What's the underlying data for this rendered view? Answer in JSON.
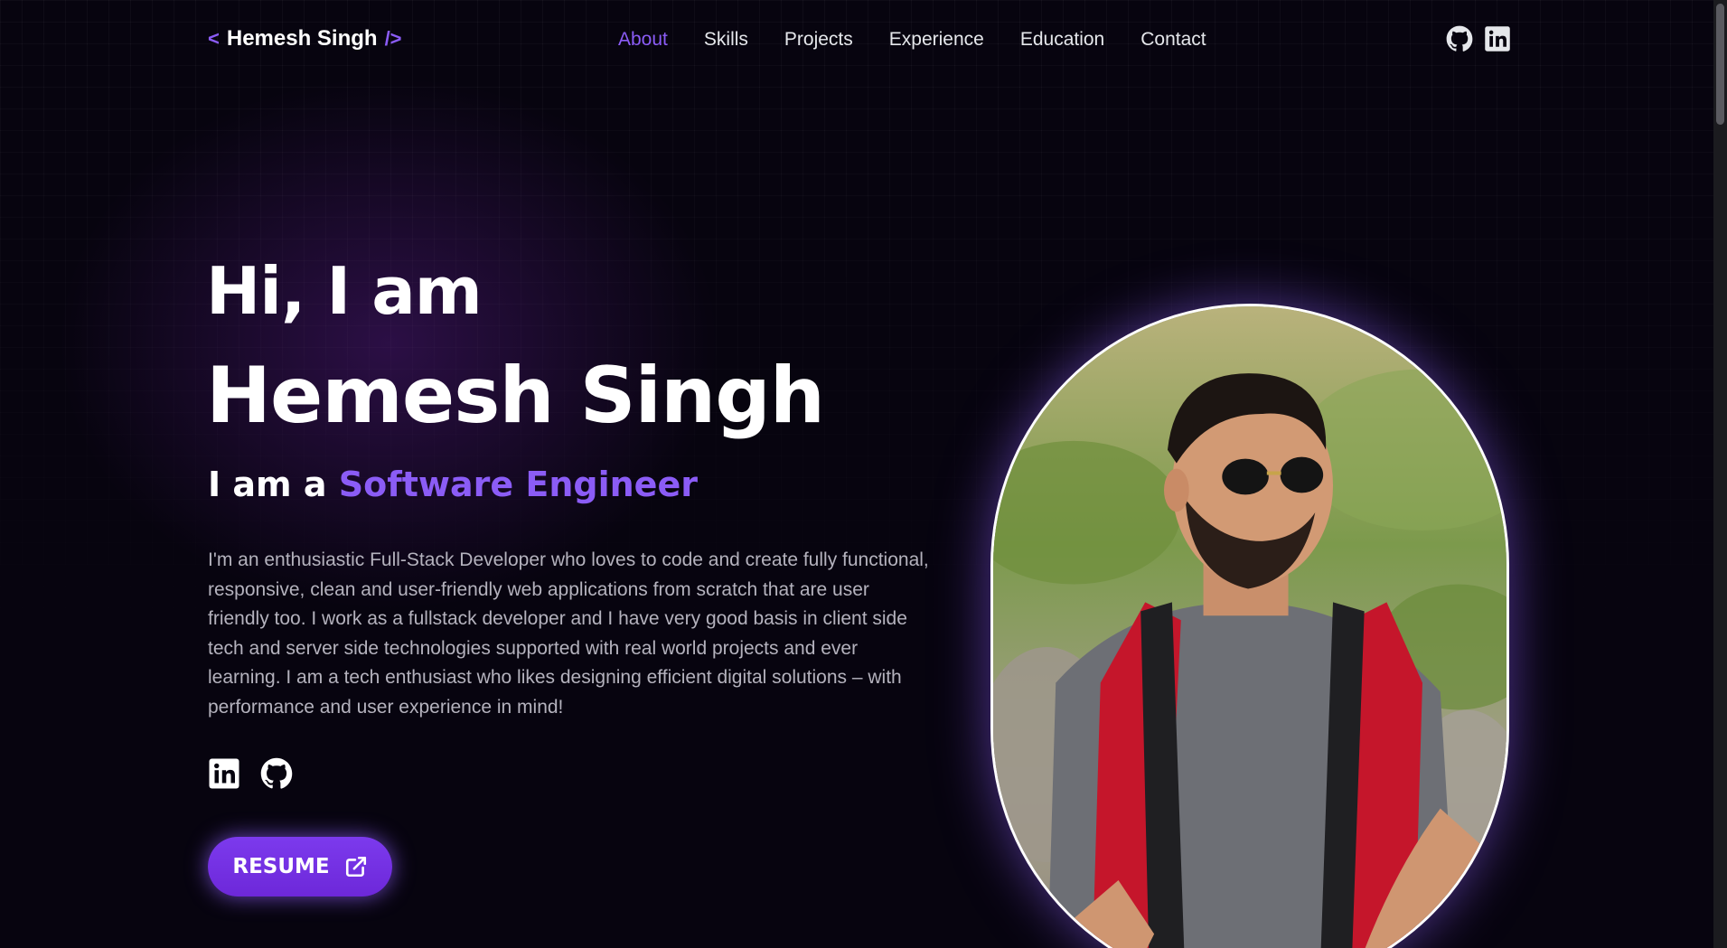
{
  "logo": {
    "open": "<",
    "text": "Hemesh Singh",
    "close": "/>"
  },
  "nav": {
    "items": [
      {
        "label": "About",
        "active": true
      },
      {
        "label": "Skills"
      },
      {
        "label": "Projects"
      },
      {
        "label": "Experience"
      },
      {
        "label": "Education"
      },
      {
        "label": "Contact"
      }
    ]
  },
  "top_icons": [
    "github-icon",
    "linkedin-icon"
  ],
  "hero": {
    "greeting": "Hi, I am",
    "name": "Hemesh Singh",
    "role_prefix": "I am a",
    "role": "Software Engineer",
    "bio": "I'm an enthusiastic Full-Stack Developer who loves to code and create fully functional, responsive, clean and user-friendly web applications from scratch that are user friendly too. I work as a fullstack developer and I have very good basis in client side tech and server side technologies supported with real world projects and ever learning. I am a tech enthusiast who likes designing efficient digital solutions – with performance and user experience in mind!",
    "socials": [
      "linkedin-icon",
      "github-icon"
    ],
    "resume_label": "RESUME",
    "resume_icon": "external-link-icon"
  },
  "colors": {
    "accent": "#8b5cf6",
    "background": "#07040f",
    "text": "#ffffff",
    "muted_text": "#b4b2bd"
  }
}
